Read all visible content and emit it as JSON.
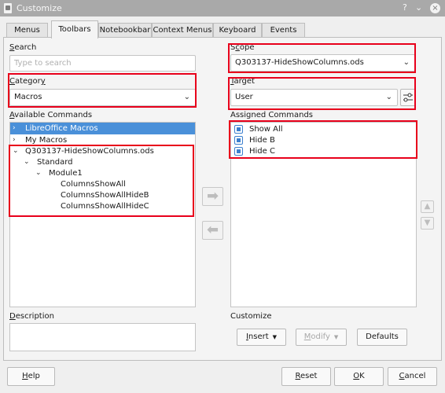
{
  "window": {
    "title": "Customize",
    "help_glyph": "?",
    "minimize_glyph": "⌄",
    "close_glyph": "×"
  },
  "tabs": [
    {
      "label": "Menus"
    },
    {
      "label": "Toolbars"
    },
    {
      "label": "Notebookbar"
    },
    {
      "label": "Context Menus"
    },
    {
      "label": "Keyboard"
    },
    {
      "label": "Events"
    }
  ],
  "search": {
    "label_first": "S",
    "label_rest": "earch",
    "placeholder": "Type to search"
  },
  "category": {
    "label_first": "C",
    "label_mid": "ategor",
    "label_u": "y",
    "value": "Macros"
  },
  "available": {
    "label_first": "A",
    "label_rest": "vailable Commands",
    "items": [
      {
        "label": "LibreOffice Macros",
        "caret": "›"
      },
      {
        "label": "My Macros",
        "caret": "›"
      },
      {
        "label": "Q303137-HideShowColumns.ods",
        "caret": "⌄"
      },
      {
        "label": "Standard",
        "caret": "⌄"
      },
      {
        "label": "Module1",
        "caret": "⌄"
      },
      {
        "label": "ColumnsShowAll"
      },
      {
        "label": "ColumnsShowAllHideB"
      },
      {
        "label": "ColumnsShowAllHideC"
      }
    ]
  },
  "description": {
    "label_first": "D",
    "label_rest": "escription"
  },
  "scope": {
    "label_pre": "S",
    "label_u": "c",
    "label_post": "ope",
    "value": "Q303137-HideShowColumns.ods"
  },
  "target": {
    "label_first": "T",
    "label_rest": "arget",
    "value": "User"
  },
  "assigned": {
    "label": "Assigned Commands",
    "items": [
      {
        "label": "Show All"
      },
      {
        "label": "Hide B"
      },
      {
        "label": "Hide C"
      }
    ]
  },
  "arrows": {
    "add": "➡",
    "remove": "⬅",
    "up": "▲",
    "down": "▼"
  },
  "customize": {
    "label": "Customize",
    "insert_pre": "I",
    "insert_post": "nsert",
    "modify_pre": "M",
    "modify_post": "odify",
    "defaults_label": "Defaults",
    "dropdown_glyph": "▼"
  },
  "footer": {
    "help_first": "H",
    "help_rest": "elp",
    "reset_first": "R",
    "reset_rest": "eset",
    "ok_first": "O",
    "ok_rest": "K",
    "cancel_first": "C",
    "cancel_rest": "ancel"
  }
}
